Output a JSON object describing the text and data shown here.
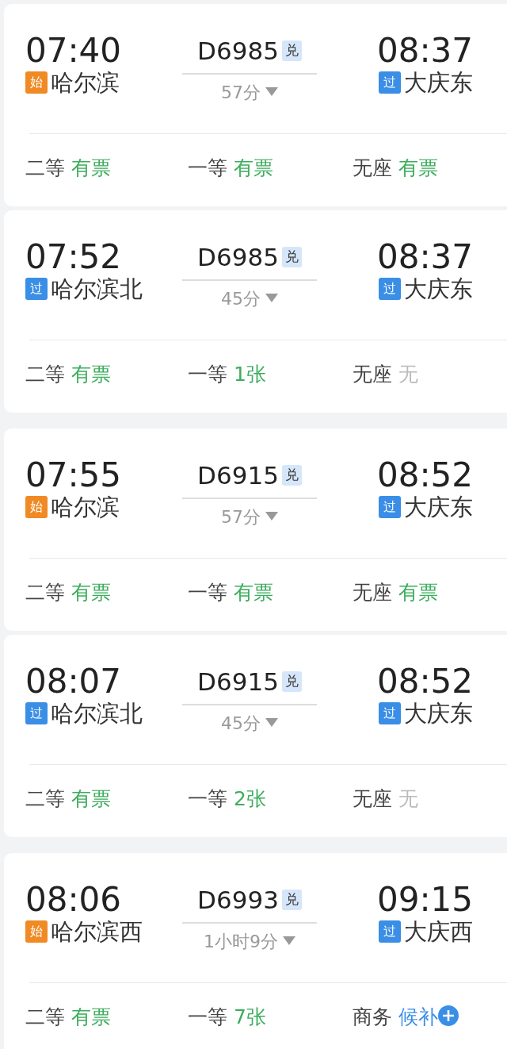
{
  "trains": [
    {
      "depart_time": "07:40",
      "depart_badge": {
        "kind": "start",
        "text": "始"
      },
      "depart_station": "哈尔滨",
      "train_no": "D6985",
      "exchange_badge": "兑",
      "duration": "57分",
      "arrive_time": "08:37",
      "arrive_badge": {
        "kind": "pass",
        "text": "过"
      },
      "arrive_station": "大庆东",
      "seats": [
        {
          "class": "二等",
          "status": "有票",
          "kind": "available"
        },
        {
          "class": "一等",
          "status": "有票",
          "kind": "available"
        },
        {
          "class": "无座",
          "status": "有票",
          "kind": "available"
        }
      ]
    },
    {
      "depart_time": "07:52",
      "depart_badge": {
        "kind": "pass",
        "text": "过"
      },
      "depart_station": "哈尔滨北",
      "train_no": "D6985",
      "exchange_badge": "兑",
      "duration": "45分",
      "arrive_time": "08:37",
      "arrive_badge": {
        "kind": "pass",
        "text": "过"
      },
      "arrive_station": "大庆东",
      "seats": [
        {
          "class": "二等",
          "status": "有票",
          "kind": "available"
        },
        {
          "class": "一等",
          "status": "1张",
          "kind": "available"
        },
        {
          "class": "无座",
          "status": "无",
          "kind": "none"
        }
      ]
    },
    {
      "depart_time": "07:55",
      "depart_badge": {
        "kind": "start",
        "text": "始"
      },
      "depart_station": "哈尔滨",
      "train_no": "D6915",
      "exchange_badge": "兑",
      "duration": "57分",
      "arrive_time": "08:52",
      "arrive_badge": {
        "kind": "pass",
        "text": "过"
      },
      "arrive_station": "大庆东",
      "seats": [
        {
          "class": "二等",
          "status": "有票",
          "kind": "available"
        },
        {
          "class": "一等",
          "status": "有票",
          "kind": "available"
        },
        {
          "class": "无座",
          "status": "有票",
          "kind": "available"
        }
      ]
    },
    {
      "depart_time": "08:07",
      "depart_badge": {
        "kind": "pass",
        "text": "过"
      },
      "depart_station": "哈尔滨北",
      "train_no": "D6915",
      "exchange_badge": "兑",
      "duration": "45分",
      "arrive_time": "08:52",
      "arrive_badge": {
        "kind": "pass",
        "text": "过"
      },
      "arrive_station": "大庆东",
      "seats": [
        {
          "class": "二等",
          "status": "有票",
          "kind": "available"
        },
        {
          "class": "一等",
          "status": "2张",
          "kind": "available"
        },
        {
          "class": "无座",
          "status": "无",
          "kind": "none"
        }
      ]
    },
    {
      "depart_time": "08:06",
      "depart_badge": {
        "kind": "start",
        "text": "始"
      },
      "depart_station": "哈尔滨西",
      "train_no": "D6993",
      "exchange_badge": "兑",
      "duration": "1小时9分",
      "arrive_time": "09:15",
      "arrive_badge": {
        "kind": "pass",
        "text": "过"
      },
      "arrive_station": "大庆西",
      "seats": [
        {
          "class": "二等",
          "status": "有票",
          "kind": "available"
        },
        {
          "class": "一等",
          "status": "7张",
          "kind": "available"
        },
        {
          "class": "商务",
          "status": "候补",
          "kind": "waitlist"
        }
      ]
    }
  ]
}
